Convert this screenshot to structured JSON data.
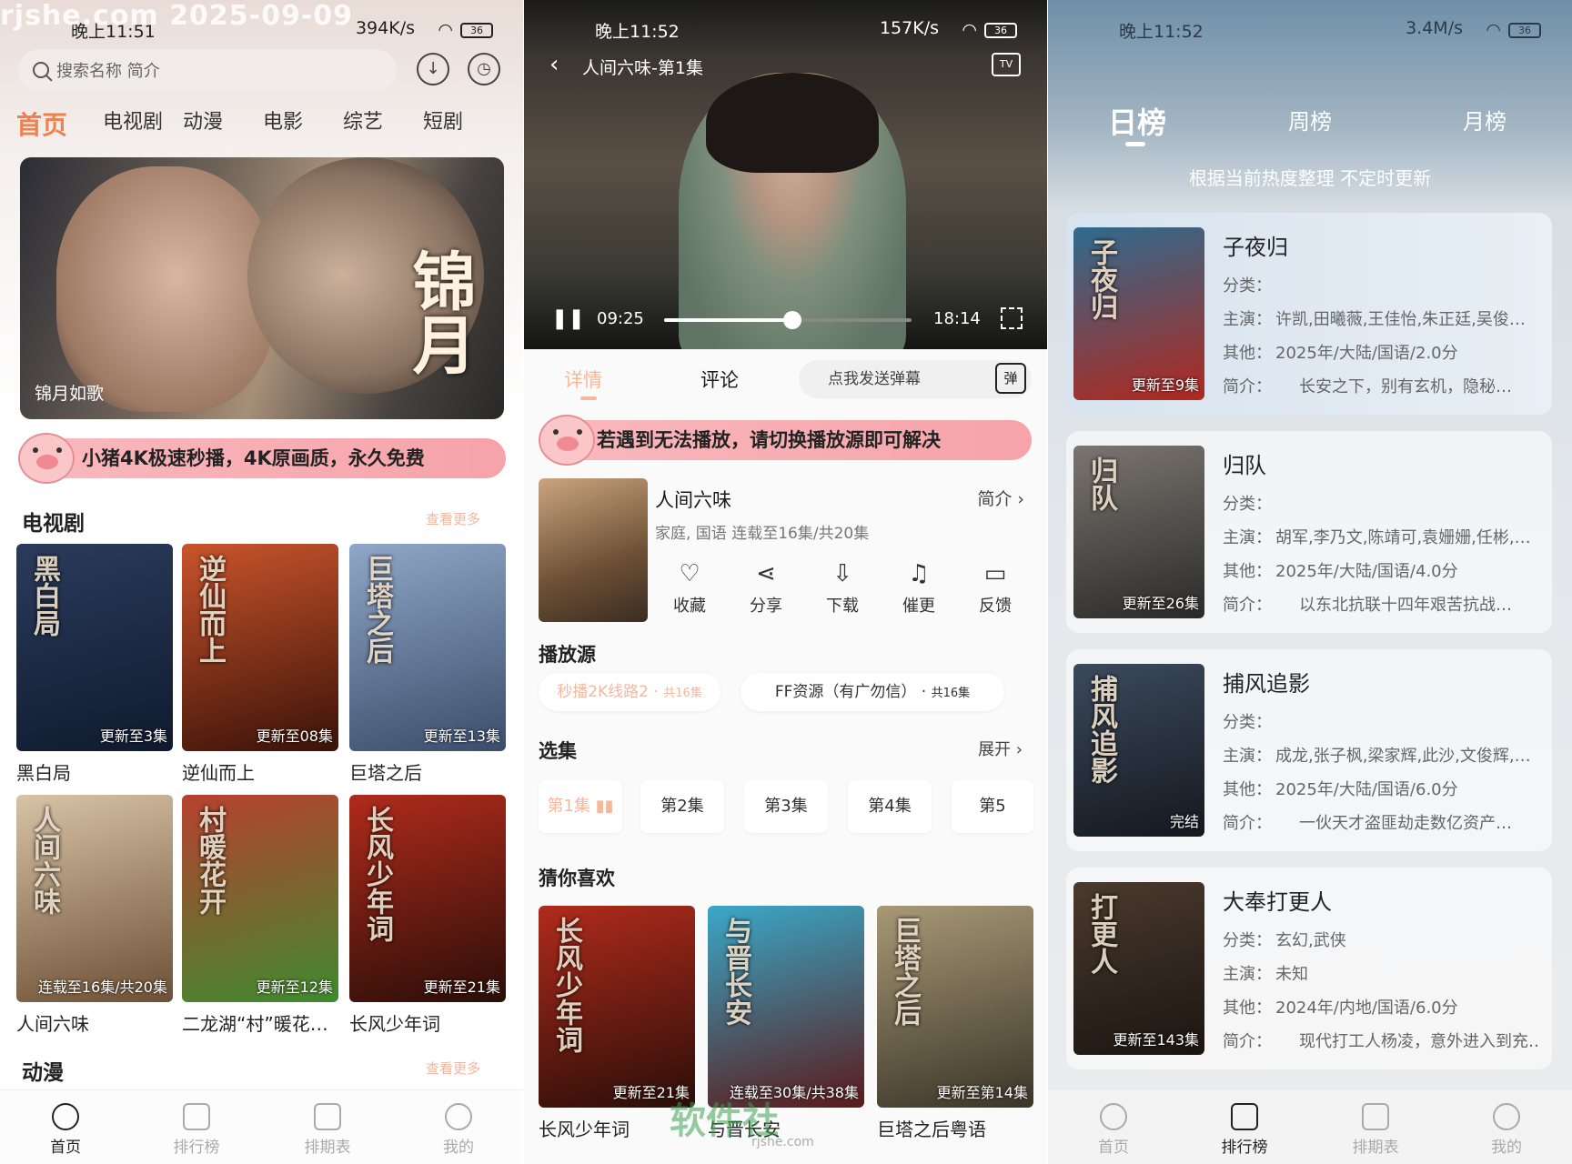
{
  "watermark": "rjshe.com 2025-09-09",
  "panel1": {
    "status": {
      "time": "晚上11:51",
      "speed": "394K/s",
      "battery": "36"
    },
    "search_placeholder": "搜索名称 简介",
    "tabs": [
      "首页",
      "电视剧",
      "动漫",
      "电影",
      "综艺",
      "短剧"
    ],
    "banner": {
      "calligraphy": "锦月",
      "caption": "锦月如歌"
    },
    "promo": "小猪4K极速秒播，4K原画质，永久免费",
    "tv_section": {
      "title": "电视剧",
      "more": "查看更多"
    },
    "tv_items": [
      {
        "title": "黑白局",
        "badge": "更新至3集",
        "color1": "#2a3b5b",
        "color2": "#0f1a2e",
        "poster_text": "黑白局"
      },
      {
        "title": "逆仙而上",
        "badge": "更新至08集",
        "color1": "#c9542c",
        "color2": "#3a1208",
        "poster_text": "逆仙而上"
      },
      {
        "title": "巨塔之后",
        "badge": "更新至13集",
        "color1": "#8fa7c8",
        "color2": "#3b4d6a",
        "poster_text": "巨塔之后"
      },
      {
        "title": "人间六味",
        "badge": "连载至16集/共20集",
        "color1": "#d8c3a6",
        "color2": "#6d5035",
        "poster_text": "人间六味"
      },
      {
        "title": "二龙湖“村”暖花…",
        "badge": "更新至12集",
        "color1": "#b84030",
        "color2": "#3f8a2f",
        "poster_text": "村暖花开"
      },
      {
        "title": "长风少年词",
        "badge": "更新至21集",
        "color1": "#b02b1c",
        "color2": "#2a0e08",
        "poster_text": "长风少年词"
      }
    ],
    "anime_section": {
      "title": "动漫",
      "more": "查看更多"
    },
    "nav": [
      "首页",
      "排行榜",
      "排期表",
      "我的"
    ]
  },
  "panel2": {
    "status": {
      "time": "晚上11:52",
      "speed": "157K/s",
      "battery": "36"
    },
    "video_title": "人间六味-第1集",
    "tv_label": "TV",
    "current_time": "09:25",
    "total_time": "18:14",
    "progress": 0.52,
    "tabs": [
      "详情",
      "评论"
    ],
    "danmu_placeholder": "点我发送弹幕",
    "danmu_icon": "弹",
    "notice": "若遇到无法播放，请切换播放源即可解决",
    "show": {
      "title": "人间六味",
      "intro": "简介",
      "meta": "家庭, 国语 连载至16集/共20集"
    },
    "actions": [
      "收藏",
      "分享",
      "下载",
      "催更",
      "反馈"
    ],
    "source_section": "播放源",
    "sources": [
      {
        "name": "秒播2K线路2",
        "count": "共16集"
      },
      {
        "name": "FF资源（有广勿信）",
        "count": "共16集"
      }
    ],
    "episode_section": "选集",
    "expand": "展开",
    "episodes": [
      "第1集",
      "第2集",
      "第3集",
      "第4集",
      "第5"
    ],
    "recommend_section": "猜你喜欢",
    "recommend": [
      {
        "title": "长风少年词",
        "badge": "更新至21集",
        "color1": "#b02b1c",
        "color2": "#2a0e08",
        "poster_text": "长风少年词"
      },
      {
        "title": "与晋长安",
        "badge": "连载至30集/共38集",
        "color1": "#3aa8c8",
        "color2": "#5a1a1a",
        "poster_text": "与晋长安"
      },
      {
        "title": "巨塔之后粤语",
        "badge": "更新至第14集",
        "color1": "#a89876",
        "color2": "#3a3528",
        "poster_text": "巨塔之后"
      }
    ],
    "watermark": "软件社",
    "watermark_url": "rjshe.com"
  },
  "panel3": {
    "status": {
      "time": "晚上11:52",
      "speed": "3.4M/s",
      "battery": "36"
    },
    "tabs": [
      "日榜",
      "周榜",
      "月榜"
    ],
    "note": "根据当前热度整理 不定时更新",
    "labels": {
      "category": "分类：",
      "cast": "主演：",
      "other": "其他：",
      "intro": "简介："
    },
    "items": [
      {
        "title": "子夜归",
        "category": "",
        "cast": "许凯,田曦薇,王佳怡,朱正廷,吴俊…",
        "other": "2025年/大陆/国语/2.0分",
        "intro": "长安之下，别有玄机，隐秘…",
        "badge": "更新至9集",
        "color1": "#2f6b8e",
        "color2": "#b0281f",
        "poster_text": "子夜归"
      },
      {
        "title": "归队",
        "category": "",
        "cast": "胡军,李乃文,陈靖可,袁姗姗,任彬,…",
        "other": "2025年/大陆/国语/4.0分",
        "intro": "以东北抗联十四年艰苦抗战…",
        "badge": "更新至26集",
        "color1": "#7a7570",
        "color2": "#2b2a28",
        "poster_text": "归队"
      },
      {
        "title": "捕风追影",
        "category": "",
        "cast": "成龙,张子枫,梁家辉,此沙,文俊辉,…",
        "other": "2025年/大陆/国语/6.0分",
        "intro": "一伙天才盗匪劫走数亿资产…",
        "badge": "完结",
        "color1": "#3b4a5c",
        "color2": "#14181f",
        "poster_text": "捕风追影"
      },
      {
        "title": "大奉打更人",
        "category": "玄幻,武侠",
        "cast": "未知",
        "other": "2024年/内地/国语/6.0分",
        "intro": "现代打工人杨凌，意外进入到充…",
        "badge": "更新至143集",
        "color1": "#4a3a2e",
        "color2": "#1b1510",
        "poster_text": "打更人"
      }
    ],
    "nav": [
      "首页",
      "排行榜",
      "排期表",
      "我的"
    ]
  }
}
